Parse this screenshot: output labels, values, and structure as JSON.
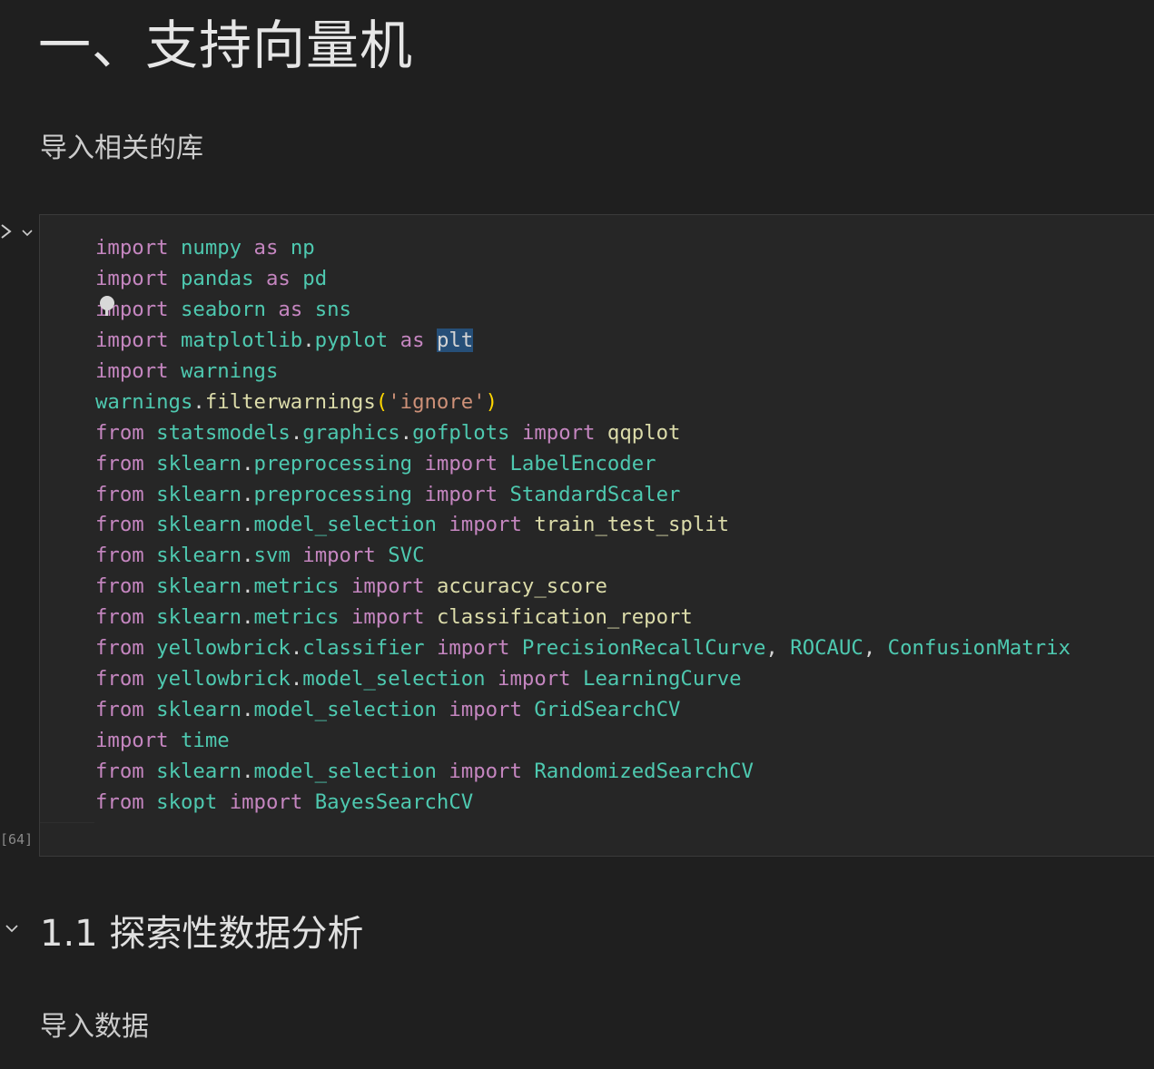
{
  "notebook": {
    "title": "一、支持向量机",
    "intro_text": "导入相关的库",
    "cell": {
      "execution_count": "[64]",
      "lines": [
        [
          [
            "kw",
            "import"
          ],
          [
            "t",
            " "
          ],
          [
            "mod",
            "numpy"
          ],
          [
            "t",
            " "
          ],
          [
            "kw",
            "as"
          ],
          [
            "t",
            " "
          ],
          [
            "al",
            "np"
          ]
        ],
        [
          [
            "kw",
            "import"
          ],
          [
            "t",
            " "
          ],
          [
            "mod",
            "pandas"
          ],
          [
            "t",
            " "
          ],
          [
            "kw",
            "as"
          ],
          [
            "t",
            " "
          ],
          [
            "al",
            "pd"
          ]
        ],
        [
          [
            "kw",
            "import"
          ],
          [
            "t",
            " "
          ],
          [
            "mod",
            "seaborn"
          ],
          [
            "t",
            " "
          ],
          [
            "kw",
            "as"
          ],
          [
            "t",
            " "
          ],
          [
            "al",
            "sns"
          ]
        ],
        [
          [
            "kw",
            "import"
          ],
          [
            "t",
            " "
          ],
          [
            "mod",
            "matplotlib"
          ],
          [
            "t",
            "."
          ],
          [
            "mod",
            "pyplot"
          ],
          [
            "t",
            " "
          ],
          [
            "kw",
            "as"
          ],
          [
            "t",
            " "
          ],
          [
            "sel",
            "plt"
          ]
        ],
        [
          [
            "kw",
            "import"
          ],
          [
            "t",
            " "
          ],
          [
            "mod",
            "warnings"
          ]
        ],
        [
          [
            "mod",
            "warnings"
          ],
          [
            "t",
            "."
          ],
          [
            "fn",
            "filterwarnings"
          ],
          [
            "pn",
            "("
          ],
          [
            "st",
            "'ignore'"
          ],
          [
            "pn",
            ")"
          ]
        ],
        [
          [
            "kw",
            "from"
          ],
          [
            "t",
            " "
          ],
          [
            "mod",
            "statsmodels"
          ],
          [
            "t",
            "."
          ],
          [
            "mod",
            "graphics"
          ],
          [
            "t",
            "."
          ],
          [
            "mod",
            "gofplots"
          ],
          [
            "t",
            " "
          ],
          [
            "kw",
            "import"
          ],
          [
            "t",
            " "
          ],
          [
            "fn",
            "qqplot"
          ]
        ],
        [
          [
            "kw",
            "from"
          ],
          [
            "t",
            " "
          ],
          [
            "mod",
            "sklearn"
          ],
          [
            "t",
            "."
          ],
          [
            "mod",
            "preprocessing"
          ],
          [
            "t",
            " "
          ],
          [
            "kw",
            "import"
          ],
          [
            "t",
            " "
          ],
          [
            "al",
            "LabelEncoder"
          ]
        ],
        [
          [
            "kw",
            "from"
          ],
          [
            "t",
            " "
          ],
          [
            "mod",
            "sklearn"
          ],
          [
            "t",
            "."
          ],
          [
            "mod",
            "preprocessing"
          ],
          [
            "t",
            " "
          ],
          [
            "kw",
            "import"
          ],
          [
            "t",
            " "
          ],
          [
            "al",
            "StandardScaler"
          ]
        ],
        [
          [
            "kw",
            "from"
          ],
          [
            "t",
            " "
          ],
          [
            "mod",
            "sklearn"
          ],
          [
            "t",
            "."
          ],
          [
            "mod",
            "model_selection"
          ],
          [
            "t",
            " "
          ],
          [
            "kw",
            "import"
          ],
          [
            "t",
            " "
          ],
          [
            "fn",
            "train_test_split"
          ]
        ],
        [
          [
            "kw",
            "from"
          ],
          [
            "t",
            " "
          ],
          [
            "mod",
            "sklearn"
          ],
          [
            "t",
            "."
          ],
          [
            "mod",
            "svm"
          ],
          [
            "t",
            " "
          ],
          [
            "kw",
            "import"
          ],
          [
            "t",
            " "
          ],
          [
            "al",
            "SVC"
          ]
        ],
        [
          [
            "kw",
            "from"
          ],
          [
            "t",
            " "
          ],
          [
            "mod",
            "sklearn"
          ],
          [
            "t",
            "."
          ],
          [
            "mod",
            "metrics"
          ],
          [
            "t",
            " "
          ],
          [
            "kw",
            "import"
          ],
          [
            "t",
            " "
          ],
          [
            "fn",
            "accuracy_score"
          ]
        ],
        [
          [
            "kw",
            "from"
          ],
          [
            "t",
            " "
          ],
          [
            "mod",
            "sklearn"
          ],
          [
            "t",
            "."
          ],
          [
            "mod",
            "metrics"
          ],
          [
            "t",
            " "
          ],
          [
            "kw",
            "import"
          ],
          [
            "t",
            " "
          ],
          [
            "fn",
            "classification_report"
          ]
        ],
        [
          [
            "kw",
            "from"
          ],
          [
            "t",
            " "
          ],
          [
            "mod",
            "yellowbrick"
          ],
          [
            "t",
            "."
          ],
          [
            "mod",
            "classifier"
          ],
          [
            "t",
            " "
          ],
          [
            "kw",
            "import"
          ],
          [
            "t",
            " "
          ],
          [
            "al",
            "PrecisionRecallCurve"
          ],
          [
            "t",
            ", "
          ],
          [
            "al",
            "ROCAUC"
          ],
          [
            "t",
            ", "
          ],
          [
            "al",
            "ConfusionMatrix"
          ]
        ],
        [
          [
            "kw",
            "from"
          ],
          [
            "t",
            " "
          ],
          [
            "mod",
            "yellowbrick"
          ],
          [
            "t",
            "."
          ],
          [
            "mod",
            "model_selection"
          ],
          [
            "t",
            " "
          ],
          [
            "kw",
            "import"
          ],
          [
            "t",
            " "
          ],
          [
            "al",
            "LearningCurve"
          ]
        ],
        [
          [
            "kw",
            "from"
          ],
          [
            "t",
            " "
          ],
          [
            "mod",
            "sklearn"
          ],
          [
            "t",
            "."
          ],
          [
            "mod",
            "model_selection"
          ],
          [
            "t",
            " "
          ],
          [
            "kw",
            "import"
          ],
          [
            "t",
            " "
          ],
          [
            "al",
            "GridSearchCV"
          ]
        ],
        [
          [
            "kw",
            "import"
          ],
          [
            "t",
            " "
          ],
          [
            "al",
            "time"
          ]
        ],
        [
          [
            "kw",
            "from"
          ],
          [
            "t",
            " "
          ],
          [
            "mod",
            "sklearn"
          ],
          [
            "t",
            "."
          ],
          [
            "mod",
            "model_selection"
          ],
          [
            "t",
            " "
          ],
          [
            "kw",
            "import"
          ],
          [
            "t",
            " "
          ],
          [
            "al",
            "RandomizedSearchCV"
          ]
        ],
        [
          [
            "kw",
            "from"
          ],
          [
            "t",
            " "
          ],
          [
            "mod",
            "skopt"
          ],
          [
            "t",
            " "
          ],
          [
            "kw",
            "import"
          ],
          [
            "t",
            " "
          ],
          [
            "al",
            "BayesSearchCV"
          ]
        ]
      ]
    },
    "section": {
      "heading": "1.1 探索性数据分析",
      "text": "导入数据"
    },
    "icons": {
      "run": "run-cell-icon",
      "collapse": "chevron-down-icon",
      "section_fold": "chevron-down-icon"
    },
    "colors": {
      "background": "#1f1f1f",
      "cell_background": "#262626",
      "keyword": "#c586c0",
      "module": "#4ec9b0",
      "function": "#dcdcaa",
      "string": "#ce9178",
      "selection": "#264f78"
    }
  }
}
